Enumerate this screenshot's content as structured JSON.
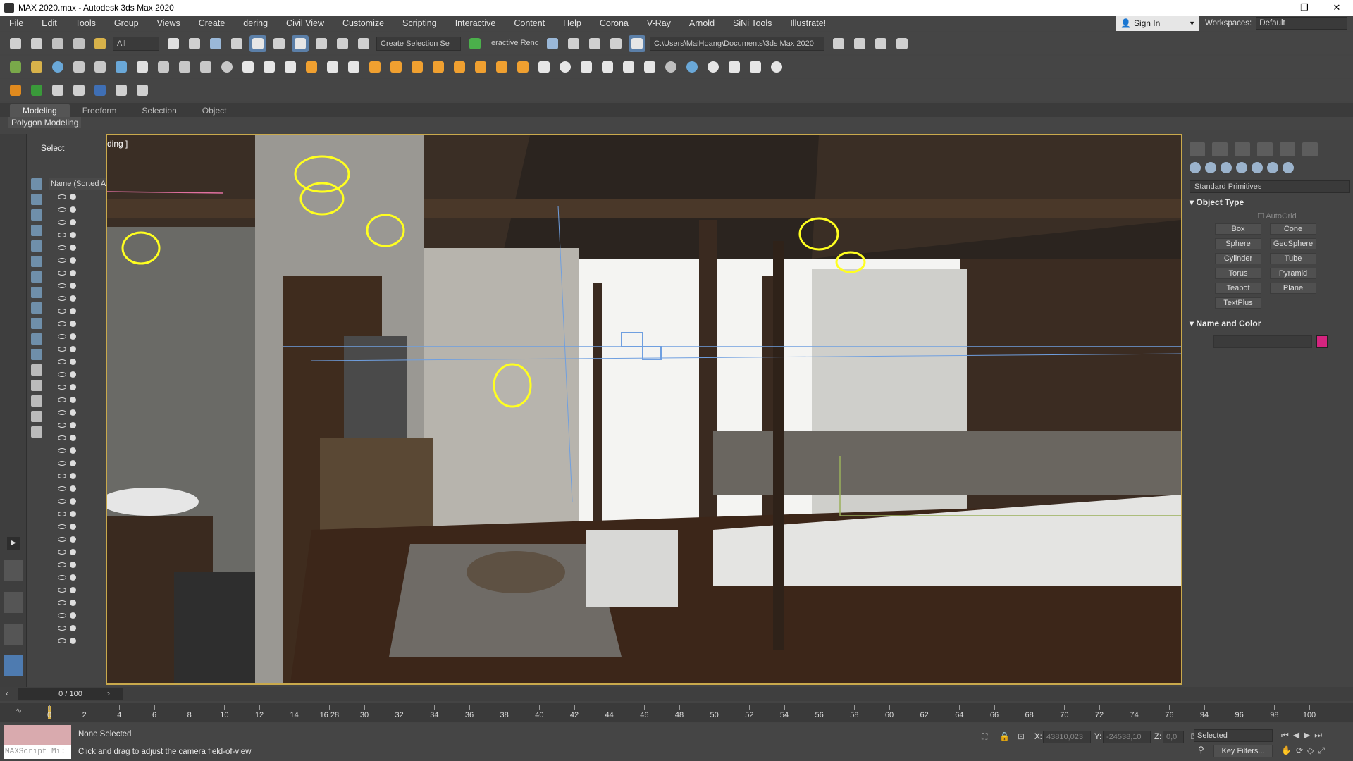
{
  "window": {
    "title": "MAX 2020.max - Autodesk 3ds Max 2020"
  },
  "menu": [
    "File",
    "Edit",
    "Tools",
    "Group",
    "Views",
    "Create",
    "dering",
    "Civil View",
    "Customize",
    "Scripting",
    "Interactive",
    "Content",
    "Help",
    "Corona",
    "V-Ray",
    "Arnold",
    "SiNi Tools",
    "Illustrate!"
  ],
  "account": {
    "signin": "Sign In"
  },
  "workspaces": {
    "label": "Workspaces:",
    "value": "Default"
  },
  "toolbar": {
    "filter": "All",
    "selection_set": "Create Selection Se",
    "render_mode": "eractive Rend",
    "project_path": "C:\\Users\\MaiHoang\\Documents\\3ds Max 2020"
  },
  "ribbon": {
    "tabs": [
      "Modeling",
      "Freeform",
      "Selection",
      "Object"
    ],
    "panel": "Polygon Modeling"
  },
  "explorer": {
    "title": "Select",
    "column": "Name (Sorted A"
  },
  "viewport": {
    "label": "ding ]"
  },
  "command_panel": {
    "category": "Standard Primitives",
    "object_type_title": "Object Type",
    "autogrid": "AutoGrid",
    "primitives": [
      "Box",
      "Cone",
      "Sphere",
      "GeoSphere",
      "Cylinder",
      "Tube",
      "Torus",
      "Pyramid",
      "Teapot",
      "Plane",
      "TextPlus"
    ],
    "name_color_title": "Name and Color",
    "swatch_color": "#d4247f"
  },
  "timeline": {
    "frame": "0 / 100",
    "ticks": [
      "0",
      "2",
      "4",
      "6",
      "8",
      "10",
      "12",
      "14",
      "16 28",
      "30",
      "32",
      "34",
      "36",
      "38",
      "40",
      "42",
      "44",
      "46",
      "48",
      "50",
      "52",
      "54",
      "56",
      "58",
      "60",
      "62",
      "64",
      "66",
      "68",
      "70",
      "72",
      "74",
      "76",
      "94",
      "96",
      "98",
      "100"
    ]
  },
  "status": {
    "maxscript": "MAXScript Mi:",
    "selection": "None Selected",
    "prompt": "Click and drag to adjust the camera field-of-view",
    "x_label": "X:",
    "x_value": "43810,023",
    "y_label": "Y:",
    "y_value": "-24538,10",
    "z_label": "Z:",
    "z_value": "0,0",
    "key_mode": "Selected",
    "key_filters": "Key Filters..."
  }
}
